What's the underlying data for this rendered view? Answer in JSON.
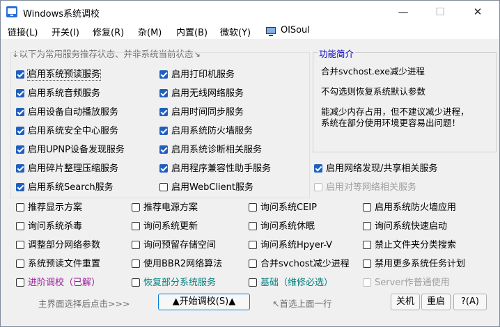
{
  "window": {
    "title": "Windows系统调校",
    "min_glyph": "—",
    "max_glyph": "☐",
    "close_glyph": "✕"
  },
  "menu": [
    "链接(L)",
    "开关(I)",
    "修复(R)",
    "杂(M)",
    "内置(B)",
    "微软(Y)"
  ],
  "olsoul": "OlSoul",
  "hint": "↓以下为常用服务推荐状态、并非系统当前状态↘",
  "features": {
    "title": "功能简介",
    "lines": [
      "合并svchost.exe减少进程",
      "不勾选则恢复系统默认参数",
      "能减少内存占用，但不建议减少进程，",
      "系统在部分使用环境更容易出问题！"
    ]
  },
  "checks": [
    {
      "label": "启用系统预读服务",
      "checked": true,
      "state": "focus"
    },
    {
      "label": "启用打印机服务",
      "checked": true
    },
    {
      "label": "启用系统音频服务",
      "checked": true
    },
    {
      "label": "启用无线网络服务",
      "checked": true
    },
    {
      "label": "启用设备自动播放服务",
      "checked": true
    },
    {
      "label": "启用时间同步服务",
      "checked": true
    },
    {
      "label": "启用系统安全中心服务",
      "checked": true
    },
    {
      "label": "启用系统防火墙服务",
      "checked": true
    },
    {
      "label": "启用UPNP设备发现服务",
      "checked": true
    },
    {
      "label": "启用系统诊断相关服务",
      "checked": true
    },
    {
      "label": "启用碎片整理压缩服务",
      "checked": true
    },
    {
      "label": "启用程序兼容性助手服务",
      "checked": true
    },
    {
      "label": "启用网络发现/共享相关服务",
      "checked": true
    },
    {
      "label": "启用系统Search服务",
      "checked": true
    },
    {
      "label": "启用WebClient服务",
      "checked": false
    },
    {
      "label": "启用对等网络相关服务",
      "checked": false,
      "state": "disabled"
    },
    {
      "label": "推荐显示方案",
      "checked": false
    },
    {
      "label": "推荐电源方案",
      "checked": false
    },
    {
      "label": "询问系统CEIP",
      "checked": false
    },
    {
      "label": "启用系统防火墙应用",
      "checked": false
    },
    {
      "label": "询问系统杀毒",
      "checked": false
    },
    {
      "label": "询问系统更新",
      "checked": false
    },
    {
      "label": "询问系统休眠",
      "checked": false
    },
    {
      "label": "询问系统快速启动",
      "checked": false
    },
    {
      "label": "调整部分网络参数",
      "checked": false
    },
    {
      "label": "询问预留存储空间",
      "checked": false
    },
    {
      "label": "询问系统Hpyer-V",
      "checked": false
    },
    {
      "label": "禁止文件夹分类搜索",
      "checked": false
    },
    {
      "label": "系统预读文件重置",
      "checked": false
    },
    {
      "label": "使用BBR2网络算法",
      "checked": false
    },
    {
      "label": "合并svchost减少进程",
      "checked": false
    },
    {
      "label": "禁用更多系统任务计划",
      "checked": false
    },
    {
      "label": "进阶调校（已解）",
      "checked": false,
      "state": "purple"
    },
    {
      "label": "恢复部分系统服务",
      "checked": false,
      "state": "teal"
    },
    {
      "label": "基础（维修必选）",
      "checked": false,
      "state": "teal"
    },
    {
      "label": "Server作普通使用",
      "checked": false,
      "state": "disabled"
    }
  ],
  "bottom": {
    "left_text": "主界面选择后点击>>>",
    "start_button": "▲开始调校(S)▲",
    "arrow_text": "↖首选上面一行",
    "btn_shutdown": "关机",
    "btn_restart": "重启",
    "btn_help": "?(A)"
  },
  "colors": {
    "checkbox_checked": "#1f5fbf",
    "group_title": "#0000c0",
    "advanced": "#9b1c9b",
    "restore": "#008080"
  }
}
